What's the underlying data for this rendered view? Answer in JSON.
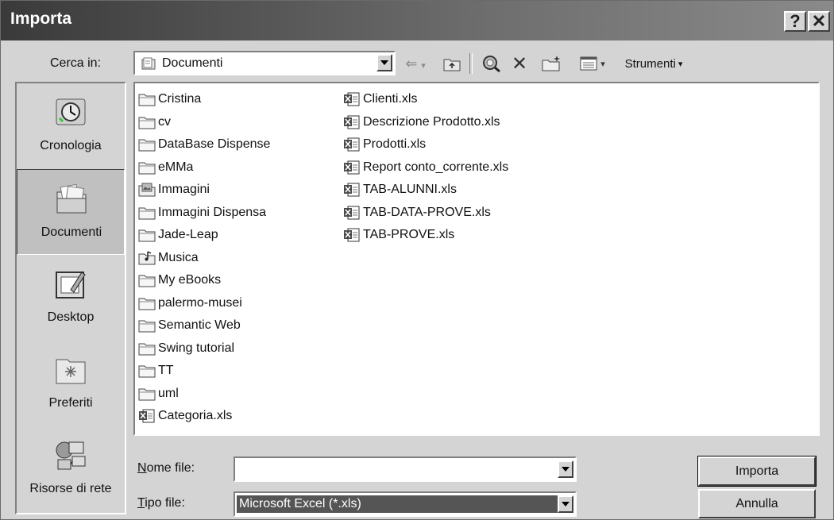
{
  "window": {
    "title": "Importa",
    "help_glyph": "?",
    "close_glyph": "✕"
  },
  "toolbar": {
    "lookin_label": "Cerca in:",
    "lookin_value": "Documenti",
    "tools_label": "Strumenti"
  },
  "places": [
    {
      "label": "Cronologia",
      "icon": "history-icon"
    },
    {
      "label": "Documenti",
      "icon": "my-documents-icon"
    },
    {
      "label": "Desktop",
      "icon": "desktop-icon"
    },
    {
      "label": "Preferiti",
      "icon": "favorites-icon"
    },
    {
      "label": "Risorse di rete",
      "icon": "network-icon"
    }
  ],
  "files_col1": [
    {
      "name": "Cristina",
      "type": "folder"
    },
    {
      "name": "cv",
      "type": "folder"
    },
    {
      "name": "DataBase Dispense",
      "type": "folder"
    },
    {
      "name": "eMMa",
      "type": "folder"
    },
    {
      "name": "Immagini",
      "type": "pictures-folder"
    },
    {
      "name": "Immagini Dispensa",
      "type": "folder"
    },
    {
      "name": "Jade-Leap",
      "type": "folder"
    },
    {
      "name": "Musica",
      "type": "music-folder"
    },
    {
      "name": "My eBooks",
      "type": "folder"
    },
    {
      "name": "palermo-musei",
      "type": "folder"
    },
    {
      "name": "Semantic Web",
      "type": "folder"
    },
    {
      "name": "Swing tutorial",
      "type": "folder"
    },
    {
      "name": "TT",
      "type": "folder"
    },
    {
      "name": "uml",
      "type": "folder"
    },
    {
      "name": "Categoria.xls",
      "type": "excel"
    }
  ],
  "files_col2": [
    {
      "name": "Clienti.xls",
      "type": "excel"
    },
    {
      "name": "Descrizione Prodotto.xls",
      "type": "excel"
    },
    {
      "name": "Prodotti.xls",
      "type": "excel"
    },
    {
      "name": "Report conto_corrente.xls",
      "type": "excel"
    },
    {
      "name": "TAB-ALUNNI.xls",
      "type": "excel"
    },
    {
      "name": "TAB-DATA-PROVE.xls",
      "type": "excel"
    },
    {
      "name": "TAB-PROVE.xls",
      "type": "excel"
    }
  ],
  "form": {
    "filename_label": "Nome file:",
    "filename_value": "",
    "filetype_label": "Tipo file:",
    "filetype_value": "Microsoft Excel (*.xls)"
  },
  "buttons": {
    "import": "Importa",
    "cancel": "Annulla"
  }
}
